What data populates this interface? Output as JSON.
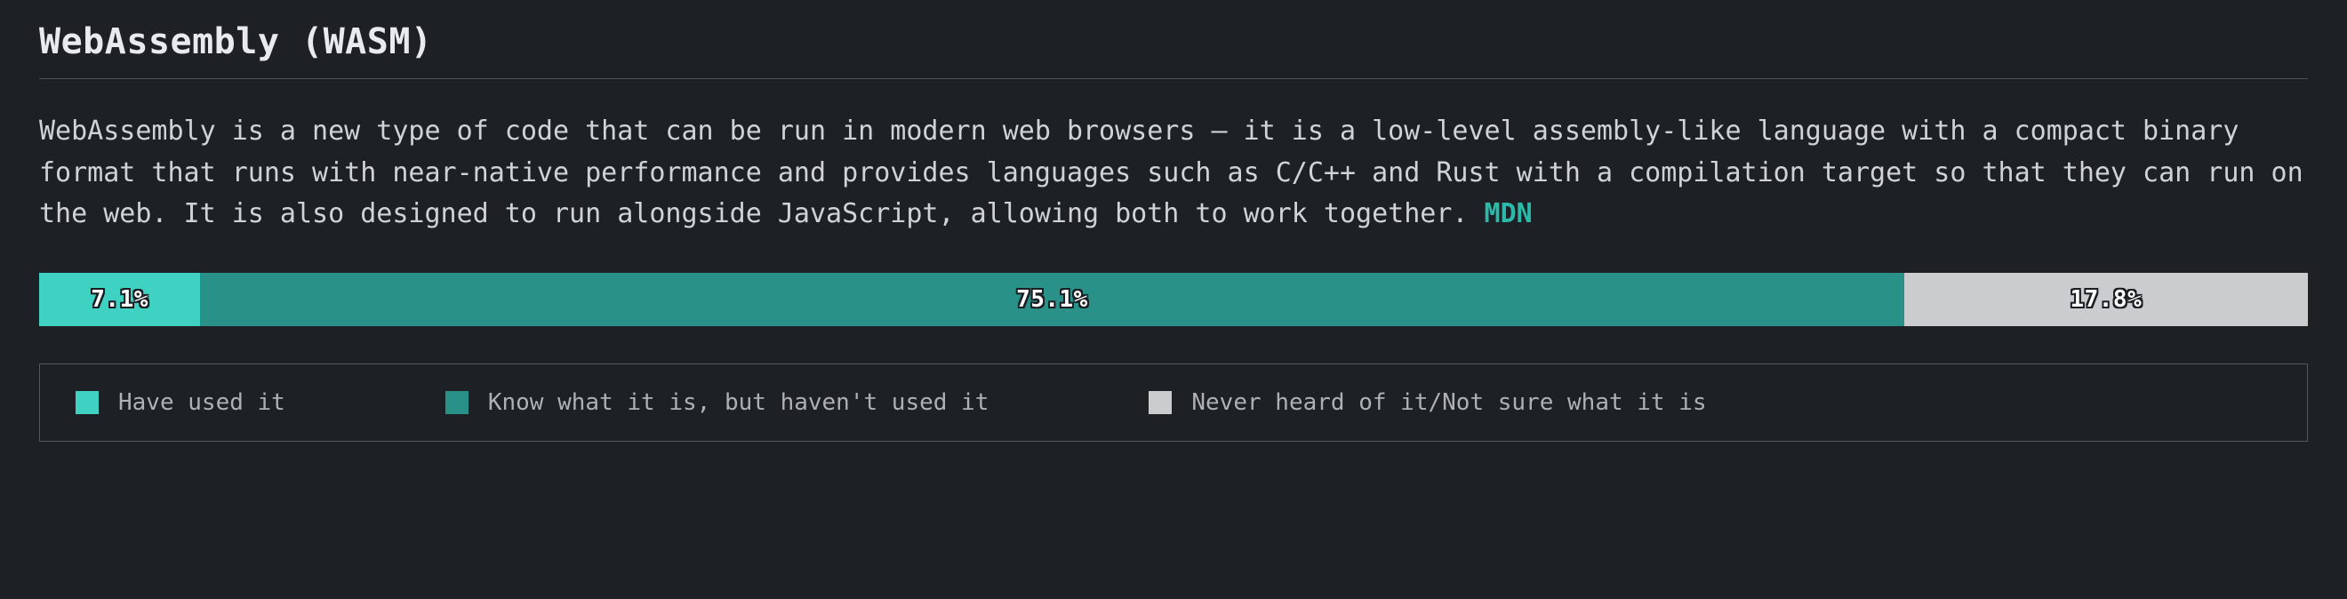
{
  "title": "WebAssembly (WASM)",
  "description": "WebAssembly is a new type of code that can be run in modern web browsers — it is a low-level assembly-like language with a compact binary format that runs with near-native performance and provides languages such as C/C++ and Rust with a compilation target so that they can run on the web. It is also designed to run alongside JavaScript, allowing both to work together. ",
  "link_label": "MDN",
  "chart_data": {
    "type": "bar",
    "orientation": "horizontal-stacked",
    "title": "WebAssembly (WASM)",
    "categories": [
      "Have used it",
      "Know what it is, but haven't used it",
      "Never heard of it/Not sure what it is"
    ],
    "values": [
      7.1,
      75.1,
      17.8
    ],
    "value_labels": [
      "7.1%",
      "75.1%",
      "17.8%"
    ],
    "colors": [
      "#3fd1c2",
      "#299187",
      "#cbccce"
    ],
    "unit": "percent",
    "total": 100
  },
  "legend": {
    "items": [
      {
        "label": "Have used it"
      },
      {
        "label": "Know what it is, but haven't used it"
      },
      {
        "label": "Never heard of it/Not sure what it is"
      }
    ]
  }
}
